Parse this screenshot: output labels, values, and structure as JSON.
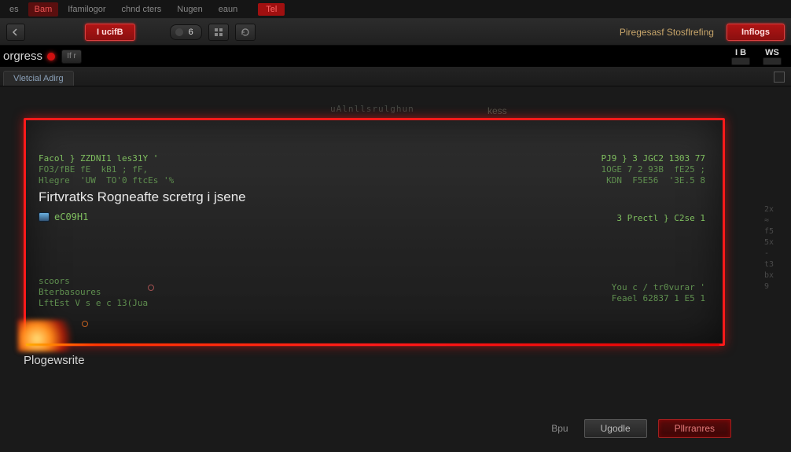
{
  "colors": {
    "accent_red": "#ff1a1a",
    "bg": "#1a1a1a",
    "console_text": "#7fbf5f"
  },
  "menubar": {
    "items": [
      {
        "label": "es"
      },
      {
        "label": "Bam",
        "active": true
      },
      {
        "label": "Ifamilogor"
      },
      {
        "label": "chnd cters"
      },
      {
        "label": "Nugen"
      },
      {
        "label": "eaun"
      }
    ],
    "highlight_label": "Tel"
  },
  "toolbar": {
    "back_icon": "chevron-left",
    "profile_label": "I ucifB",
    "counter_value": "6",
    "status_label": "Piregesasf Stosflrefing",
    "inflogs_label": "Inflogs"
  },
  "strip2": {
    "left_label": "orgress",
    "toggle_label": "If r",
    "right_blocks": [
      {
        "big": "I B",
        "tiny": ""
      },
      {
        "big": "WS",
        "tiny": ""
      }
    ]
  },
  "tabstrip": {
    "tabs": [
      {
        "label": "Vletcial Adirg"
      }
    ]
  },
  "console": {
    "left_block_a": [
      "Facol } ZZDNI1 les31Y '",
      "FO3/fBE fE  kB1 ; fF,",
      "Hlegre  'UW  TO'0 ftcEs '%"
    ],
    "right_block_a": [
      "PJ9 } 3 JGC2 1303 77",
      "1OGE 7 2 93B  fE25 ;",
      "KDN  F5E56  '3E.5 8"
    ],
    "heading": "Firtvratks Rogneafte scretrg i jsene",
    "sub_label": "eC09H1",
    "right_sub": "3 Prectl } C2se 1",
    "left_block_b": [
      "scoors",
      "Bterbasoures",
      "LftEst V s e c 13(Jua"
    ],
    "right_block_b": [
      "You c / tr0vurar '",
      "Feael 62837 1 E5 1"
    ]
  },
  "below_console_label": "Plogewsrite",
  "side_math": [
    "2x",
    "≈",
    "f5",
    "5x",
    "-",
    "t3",
    "bx",
    "9"
  ],
  "scribble_a": "uAlnllsrulghun",
  "scribble_b": "kess",
  "bottom": {
    "label": "Bpu",
    "undo_label": "Ugodle",
    "primary_label": "Pllrranres"
  }
}
